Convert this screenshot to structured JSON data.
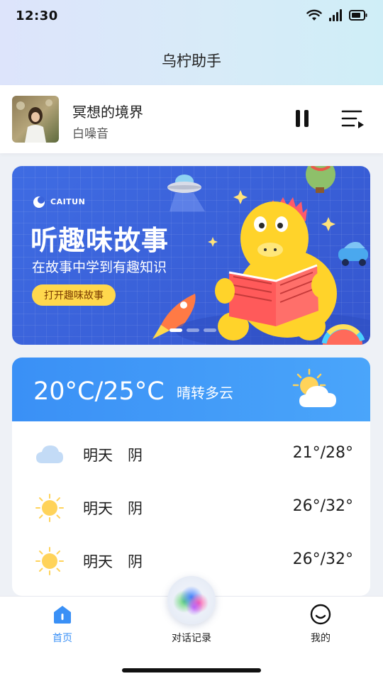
{
  "status_bar": {
    "time": "12:30"
  },
  "header": {
    "title": "乌柠助手"
  },
  "player": {
    "title": "冥想的境界",
    "subtitle": "白噪音",
    "pause_icon": "pause-icon",
    "playlist_icon": "playlist-icon"
  },
  "banner": {
    "logo_text": "CAITUN",
    "headline": "听趣味故事",
    "subtitle": "在故事中学到有趣知识",
    "button_label": "打开趣味故事",
    "page_count": 3,
    "active_page": 1
  },
  "weather": {
    "temp_range": "20°C/25°C",
    "condition": "晴转多云",
    "icon": "sun-cloud-icon",
    "forecast": [
      {
        "day": "明天",
        "condition": "阴",
        "range": "21°/28°",
        "icon": "cloud-icon"
      },
      {
        "day": "明天",
        "condition": "阴",
        "range": "26°/32°",
        "icon": "sun-icon"
      },
      {
        "day": "明天",
        "condition": "阴",
        "range": "26°/32°",
        "icon": "sun-icon"
      }
    ]
  },
  "nav": {
    "home_label": "首页",
    "chat_label": "对话记录",
    "me_label": "我的"
  },
  "colors": {
    "accent": "#3a90f6",
    "banner_bg": "#3a63da",
    "button_yellow": "#ffd84d"
  }
}
